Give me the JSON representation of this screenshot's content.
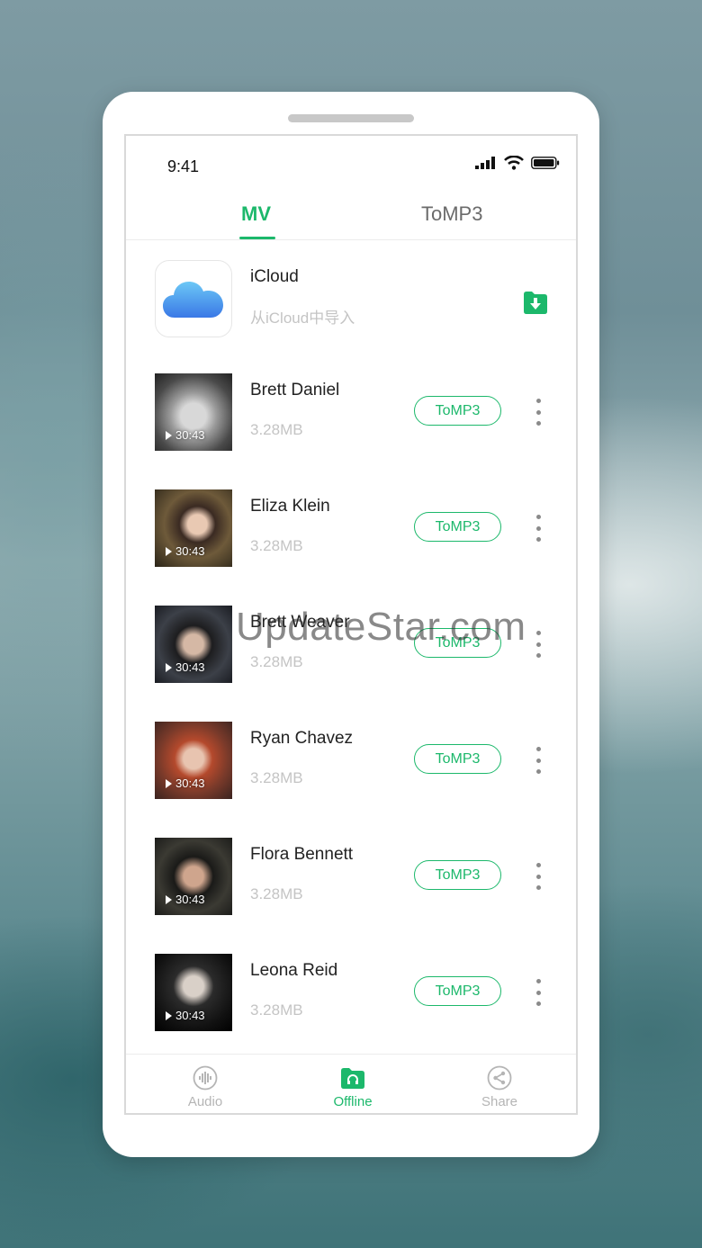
{
  "status_bar": {
    "time": "9:41"
  },
  "tabs": [
    {
      "label": "MV",
      "active": true
    },
    {
      "label": "ToMP3",
      "active": false
    }
  ],
  "icloud": {
    "title": "iCloud",
    "subtitle": "从iCloud中导入",
    "icon": "icloud-icon",
    "action_icon": "folder-download-icon"
  },
  "items": [
    {
      "name": "Brett Daniel",
      "size": "3.28MB",
      "duration": "30:43",
      "button": "ToMP3"
    },
    {
      "name": "Eliza Klein",
      "size": "3.28MB",
      "duration": "30:43",
      "button": "ToMP3"
    },
    {
      "name": "Brett Weaver",
      "size": "3.28MB",
      "duration": "30:43",
      "button": "ToMP3"
    },
    {
      "name": "Ryan Chavez",
      "size": "3.28MB",
      "duration": "30:43",
      "button": "ToMP3"
    },
    {
      "name": "Flora Bennett",
      "size": "3.28MB",
      "duration": "30:43",
      "button": "ToMP3"
    },
    {
      "name": "Leona Reid",
      "size": "3.28MB",
      "duration": "30:43",
      "button": "ToMP3"
    }
  ],
  "bottom_nav": [
    {
      "label": "Audio",
      "icon": "audio-wave-icon",
      "active": false
    },
    {
      "label": "Offline",
      "icon": "folder-headphones-icon",
      "active": true
    },
    {
      "label": "Share",
      "icon": "share-icon",
      "active": false
    }
  ],
  "watermark": "UpdateStar.com",
  "colors": {
    "accent": "#1cb86b",
    "text_primary": "#222222",
    "text_muted": "#c4c4c4"
  }
}
